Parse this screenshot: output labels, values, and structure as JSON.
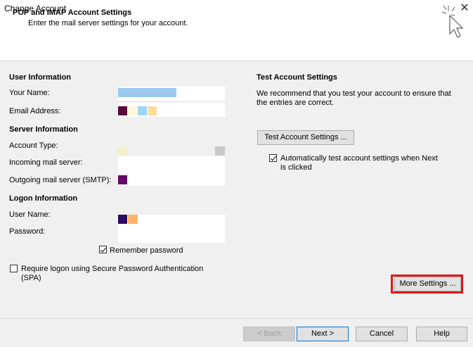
{
  "window": {
    "title": "Change Account",
    "close_glyph": "✕"
  },
  "header": {
    "title": "POP and IMAP Account Settings",
    "subtitle": "Enter the mail server settings for your account."
  },
  "user_info": {
    "heading": "User Information",
    "name_label": "Your Name:",
    "email_label": "Email Address:"
  },
  "server_info": {
    "heading": "Server Information",
    "account_type_label": "Account Type:",
    "incoming_label": "Incoming mail server:",
    "outgoing_label": "Outgoing mail server (SMTP):"
  },
  "logon_info": {
    "heading": "Logon Information",
    "username_label": "User Name:",
    "password_label": "Password:",
    "remember_label": "Remember password",
    "spa_label_line1": "Require logon using Secure Password Authentication",
    "spa_label_line2": "(SPA)"
  },
  "test_settings": {
    "heading": "Test Account Settings",
    "desc_line1": "We recommend that you test your account to ensure that",
    "desc_line2": "the entries are correct.",
    "test_button": "Test Account Settings ...",
    "auto_test_line1": "Automatically test account settings when Next",
    "auto_test_line2": "is clicked"
  },
  "buttons": {
    "more_settings": "More Settings ...",
    "back": "< Back",
    "next": "Next >",
    "cancel": "Cancel",
    "help": "Help"
  },
  "state": {
    "remember_password": true,
    "spa": false,
    "auto_test": true
  },
  "colors": {
    "highlight_border": "#e0161b",
    "name_swatch": "#9cc9f0",
    "email_swatches": [
      "#5a0a3d",
      "#fff8dc",
      "#9ad7f5",
      "#fddc9a"
    ],
    "account_type_swatches": [
      "#f2f0cc",
      "#c8c8c8"
    ],
    "outgoing_swatch": "#660a66",
    "username_swatches": [
      "#2a0a5e",
      "#fbb46a"
    ]
  }
}
